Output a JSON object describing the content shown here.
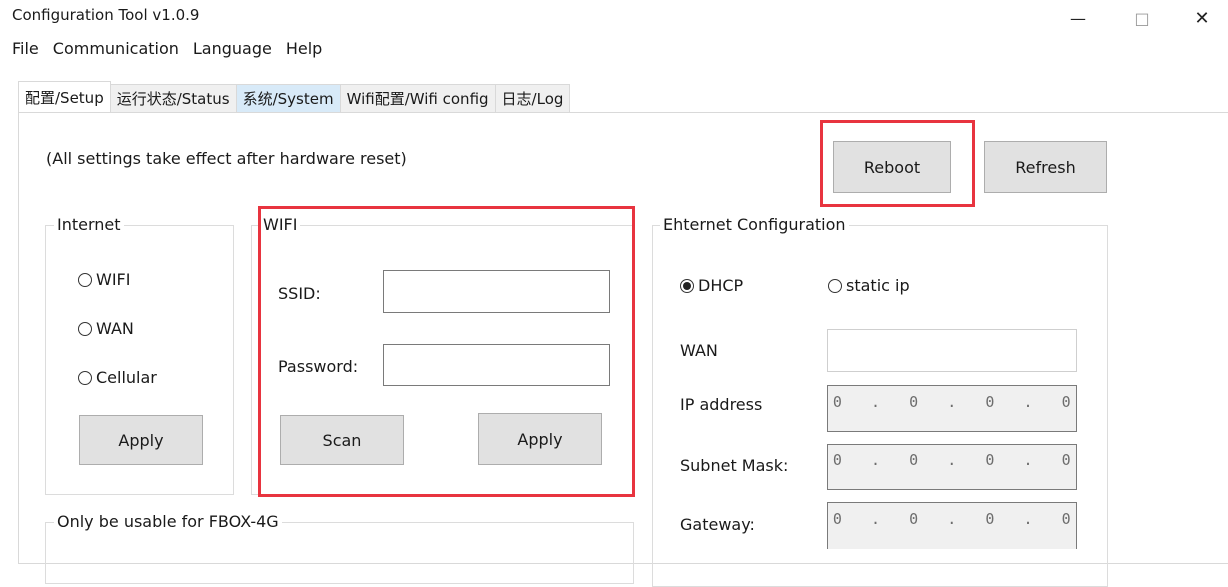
{
  "window": {
    "title": "Configuration Tool v1.0.9",
    "minimize_glyph": "—",
    "maximize_glyph": "□",
    "close_glyph": "✕"
  },
  "menu": [
    "File",
    "Communication",
    "Language",
    "Help"
  ],
  "tabs": [
    {
      "label": "配置/Setup",
      "state": "active"
    },
    {
      "label": "运行状态/Status",
      "state": "normal"
    },
    {
      "label": "系统/System",
      "state": "highlighted"
    },
    {
      "label": "Wifi配置/Wifi config",
      "state": "normal"
    },
    {
      "label": "日志/Log",
      "state": "normal"
    }
  ],
  "setup": {
    "notice": "(All settings take effect after hardware reset)",
    "reboot_label": "Reboot",
    "refresh_label": "Refresh",
    "internet": {
      "title": "Internet",
      "options": [
        "WIFI",
        "WAN",
        "Cellular"
      ],
      "selected": null,
      "apply_label": "Apply"
    },
    "wifi": {
      "title": "WIFI",
      "ssid_label": "SSID:",
      "ssid_value": "",
      "password_label": "Password:",
      "password_value": "",
      "scan_label": "Scan",
      "apply_label": "Apply"
    },
    "fbox": {
      "title": "Only be usable for FBOX-4G"
    },
    "ethernet": {
      "title": "Ehternet Configuration",
      "dhcp_label": "DHCP",
      "static_label": "static ip",
      "selected": "DHCP",
      "wan_label": "WAN",
      "wan_value": "",
      "ip_label": "IP address",
      "ip_value": "0   .   0   .   0   .   0",
      "mask_label": "Subnet Mask:",
      "mask_value": "0   .   0   .   0   .   0",
      "gateway_label": "Gateway:",
      "gateway_value": "0   .   0   .   0   .   0"
    }
  },
  "colors": {
    "highlight_box": "#e8343f",
    "tab_highlight": "#d8eaf8",
    "button_face": "#e1e1e1"
  }
}
